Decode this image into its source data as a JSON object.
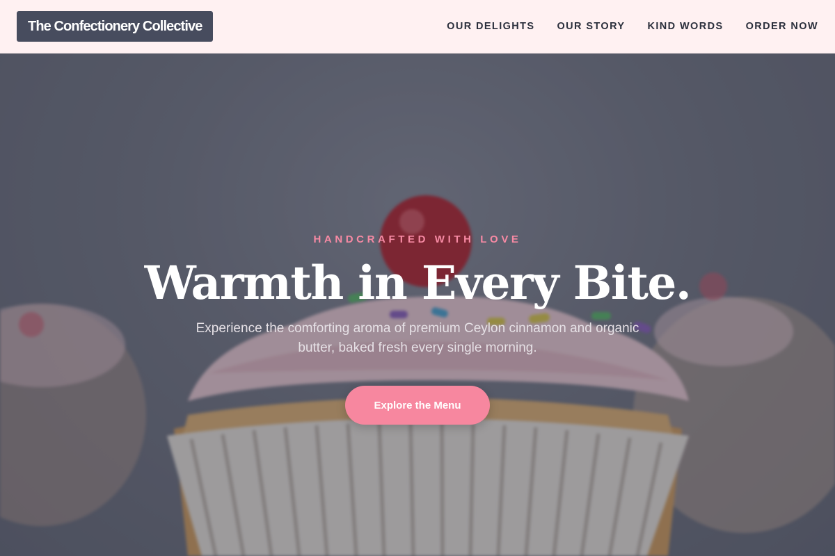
{
  "brand": {
    "name": "The Confectionery Collective"
  },
  "nav": {
    "items": [
      {
        "label": "OUR DELIGHTS"
      },
      {
        "label": "OUR STORY"
      },
      {
        "label": "KIND WORDS"
      },
      {
        "label": "ORDER NOW"
      }
    ]
  },
  "hero": {
    "tagline": "HANDCRAFTED WITH LOVE",
    "headline": "Warmth in Every Bite.",
    "subtext": "Experience the comforting aroma of premium Ceylon cinnamon and organic butter, baked fresh every single morning.",
    "cta_label": "Explore the Menu",
    "background_image": "cupcake-photo"
  },
  "colors": {
    "header_bg": "#fff1f2",
    "logo_bg": "#474c5e",
    "accent": "#f7879f",
    "nav_text": "#2b2f3c"
  }
}
